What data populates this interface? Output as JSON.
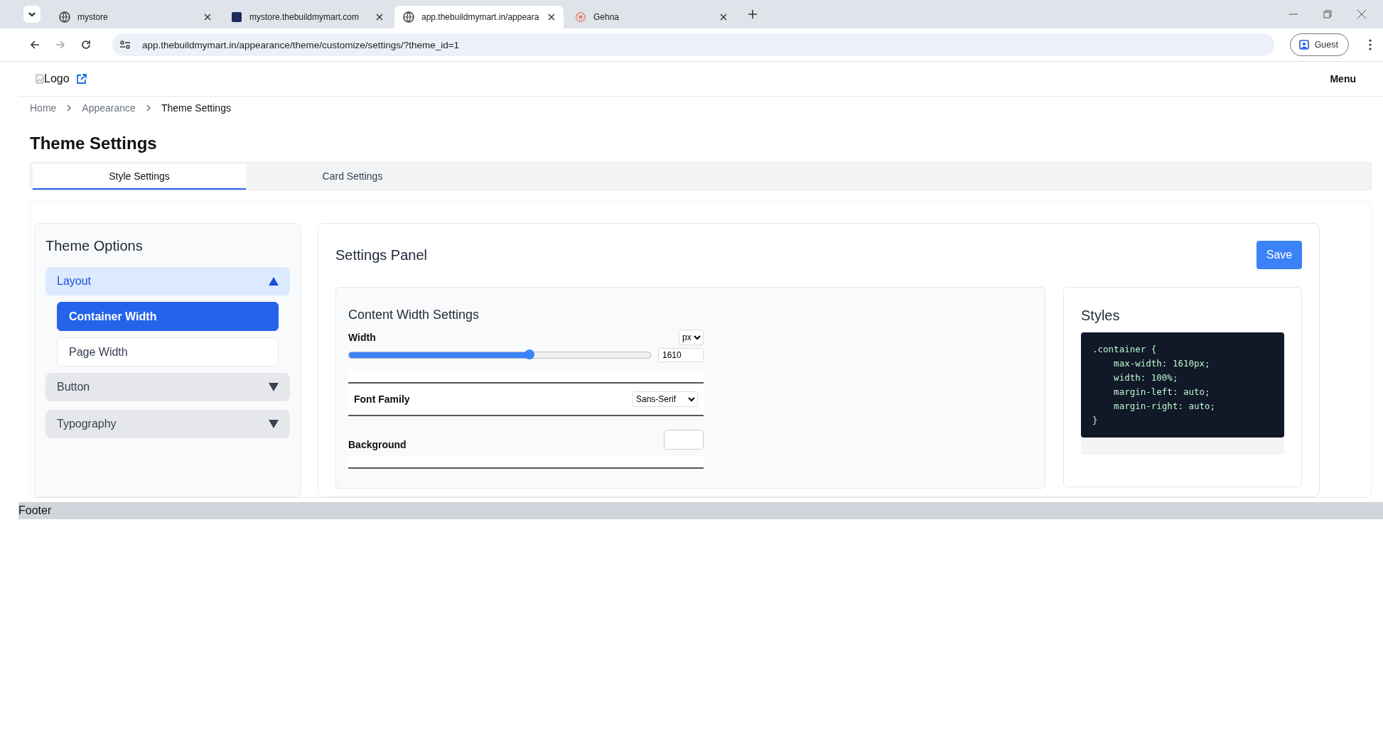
{
  "browser": {
    "tabs": [
      {
        "title": "mystore",
        "kind": "globe",
        "selected": false
      },
      {
        "title": "mystore.thebuildmymart.com",
        "kind": "square",
        "selected": false
      },
      {
        "title": "app.thebuildmymart.in/appeara",
        "kind": "globe",
        "selected": true
      },
      {
        "title": "Gehna",
        "kind": "gear",
        "selected": false
      }
    ],
    "url": "app.thebuildmymart.in/appearance/theme/customize/settings/?theme_id=1",
    "profile": "Guest"
  },
  "header": {
    "logo_alt": "Logo",
    "menu": "Menu"
  },
  "breadcrumb": [
    {
      "label": "Home",
      "current": false
    },
    {
      "label": "Appearance",
      "current": false
    },
    {
      "label": "Theme Settings",
      "current": true
    }
  ],
  "page_title": "Theme Settings",
  "tabs": [
    {
      "label": "Style Settings",
      "selected": true
    },
    {
      "label": "Card Settings",
      "selected": false
    }
  ],
  "sidebar": {
    "title": "Theme Options",
    "sections": [
      {
        "label": "Layout",
        "expanded": true,
        "items": [
          {
            "label": "Container Width",
            "selected": true
          },
          {
            "label": "Page Width",
            "selected": false
          }
        ]
      },
      {
        "label": "Button",
        "expanded": false
      },
      {
        "label": "Typography",
        "expanded": false
      }
    ]
  },
  "settings_panel": {
    "title": "Settings Panel",
    "save": "Save",
    "content": {
      "title": "Content Width Settings",
      "width": {
        "label": "Width",
        "unit": "px",
        "level": 0.6,
        "value": "1610"
      },
      "font_family": {
        "label": "Font Family",
        "value": "Sans-Serif"
      },
      "background": {
        "label": "Background"
      }
    },
    "styles": {
      "title": "Styles",
      "code": [
        ".container {",
        "    max-width: 1610px;",
        "    width: 100%;",
        "    margin-left: auto;",
        "    margin-right: auto;",
        "}"
      ]
    }
  },
  "footer": "Footer"
}
